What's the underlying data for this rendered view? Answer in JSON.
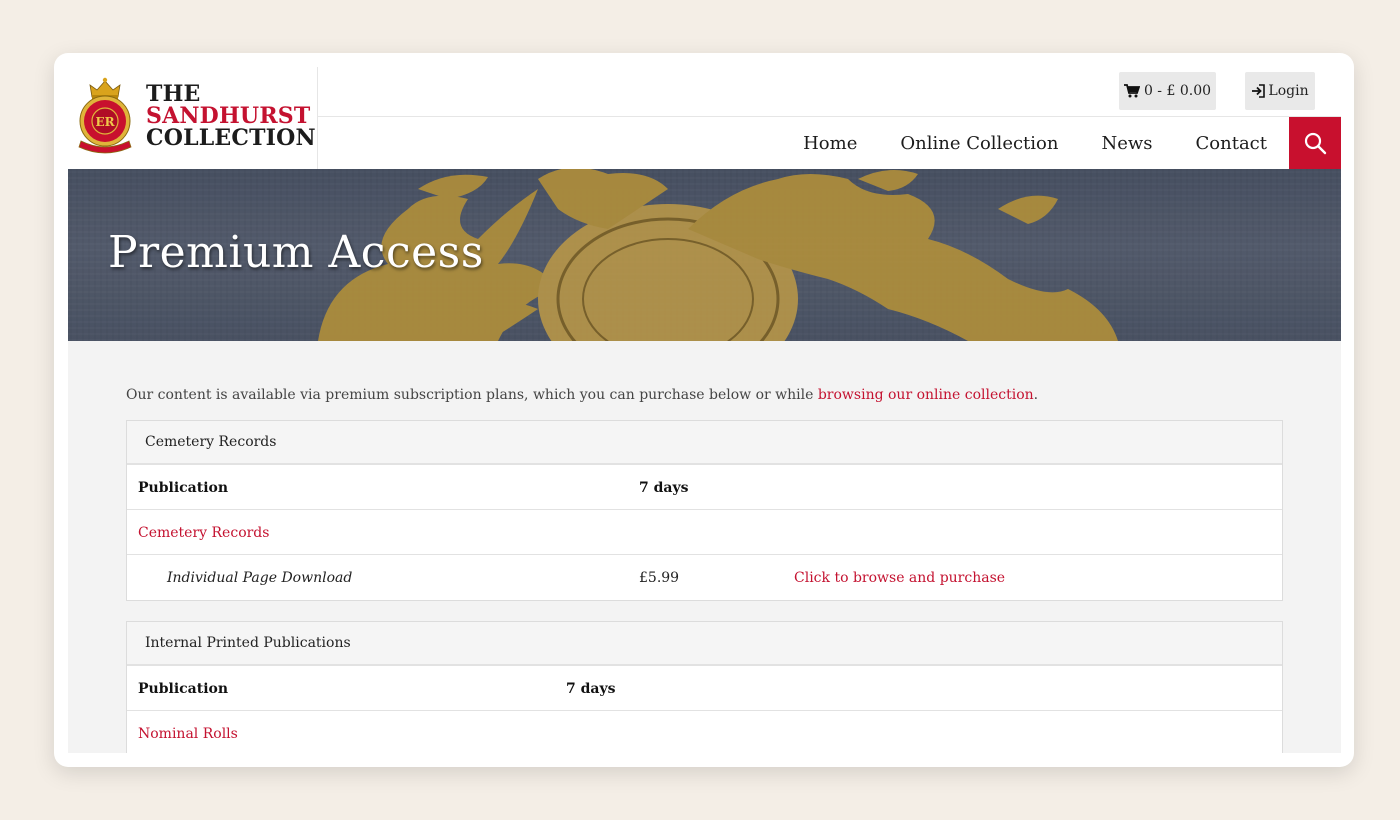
{
  "brand": {
    "line1": "THE",
    "line2": "SANDHURST",
    "line3": "COLLECTION",
    "crest_letters": "ER",
    "accent_color": "#c8102e"
  },
  "topbar": {
    "cart_label": "0 - £ 0.00",
    "login_label": "Login"
  },
  "nav": {
    "items": [
      {
        "label": "Home"
      },
      {
        "label": "Online Collection"
      },
      {
        "label": "News"
      },
      {
        "label": "Contact"
      }
    ],
    "search_icon": "search-icon"
  },
  "banner": {
    "title": "Premium Access"
  },
  "intro": {
    "text": "Our content is available via premium subscription plans, which you can purchase below or while ",
    "link": "browsing our online collection",
    "suffix": "."
  },
  "panels": [
    {
      "title": "Cemetery Records",
      "header": {
        "col1": "Publication",
        "col2": "7 days"
      },
      "group": "Cemetery Records",
      "item": {
        "name": "Individual Page Download",
        "price": "£5.99",
        "action": "Click to browse and purchase"
      }
    },
    {
      "title": "Internal Printed Publications",
      "header": {
        "col1": "Publication",
        "col2": "7 days"
      },
      "group": "Nominal Rolls"
    }
  ]
}
